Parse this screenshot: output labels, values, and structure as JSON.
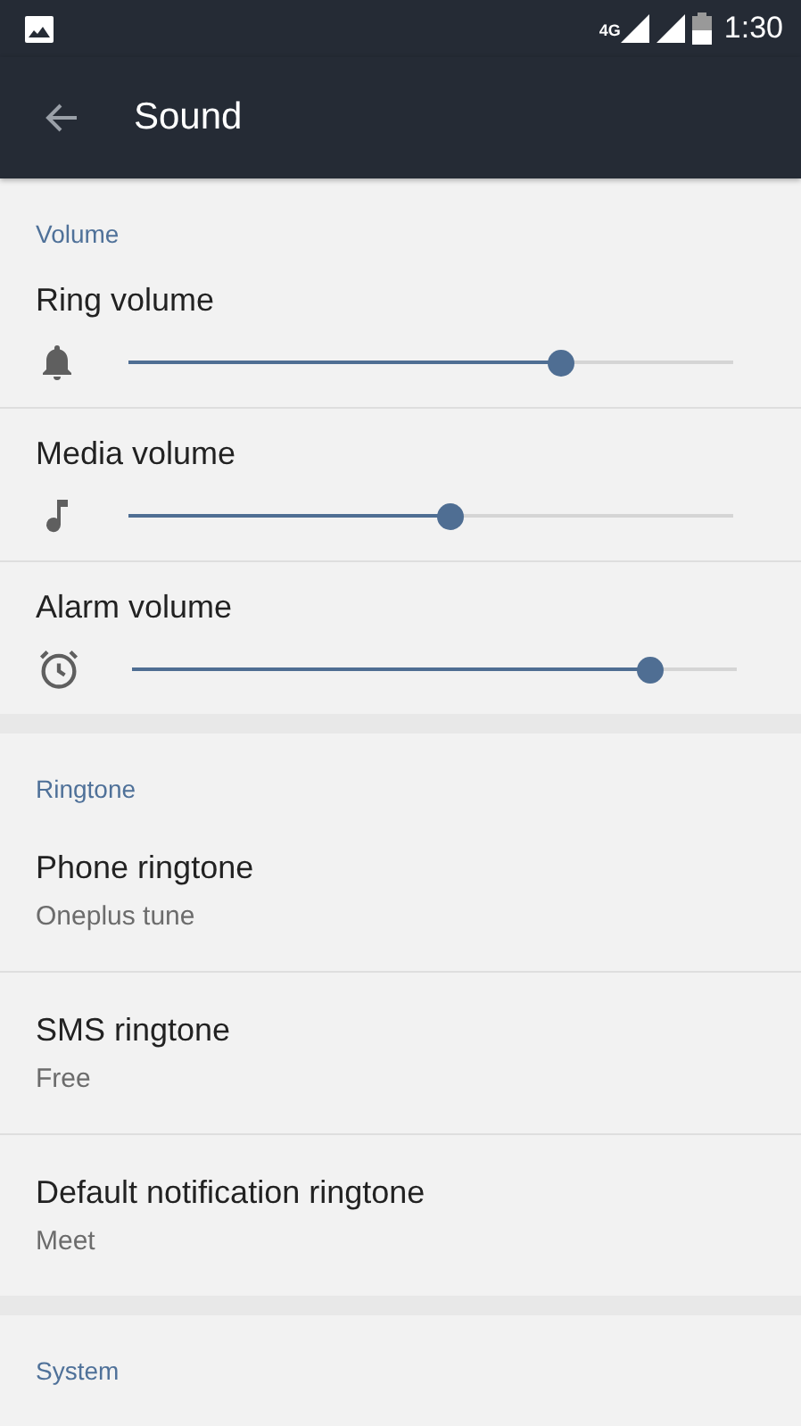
{
  "status_bar": {
    "network": "4G",
    "time": "1:30"
  },
  "toolbar": {
    "title": "Sound"
  },
  "sections": [
    {
      "header": "Volume",
      "items": [
        {
          "kind": "slider",
          "title": "Ring volume",
          "level": 0.714
        },
        {
          "kind": "slider",
          "title": "Media volume",
          "level": 0.53
        },
        {
          "kind": "slider",
          "title": "Alarm volume",
          "level": 0.855
        }
      ]
    },
    {
      "header": "Ringtone",
      "items": [
        {
          "kind": "choice",
          "title": "Phone ringtone",
          "summary": "Oneplus tune"
        },
        {
          "kind": "choice",
          "title": "SMS ringtone",
          "summary": "Free"
        },
        {
          "kind": "choice",
          "title": "Default notification ringtone",
          "summary": "Meet"
        }
      ]
    },
    {
      "header": "System"
    }
  ]
}
